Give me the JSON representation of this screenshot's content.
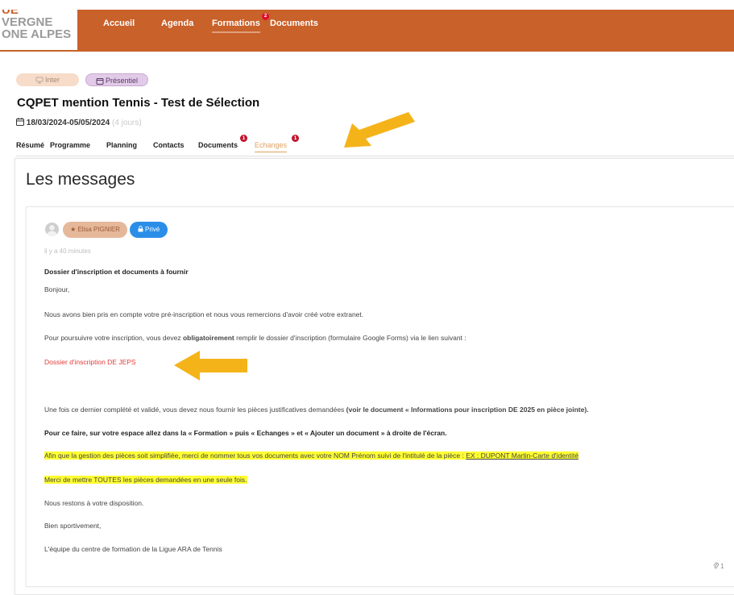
{
  "header": {
    "logo_lines": [
      "UE",
      "VERGNE",
      "ONE ALPES"
    ],
    "nav": [
      {
        "label": "Accueil"
      },
      {
        "label": "Agenda"
      },
      {
        "label": "Formations",
        "badge": "2"
      },
      {
        "label": "Documents"
      }
    ]
  },
  "training": {
    "chips": [
      {
        "label": "Inter",
        "icon": "monitor-icon"
      },
      {
        "label": "Présentiel",
        "icon": "calendar-icon"
      }
    ],
    "title": "CQPET mention Tennis - Test de Sélection",
    "dates": "18/03/2024-05/05/2024",
    "duration": "(4 jours)"
  },
  "tabs": [
    {
      "label": "Résumé"
    },
    {
      "label": "Programme"
    },
    {
      "label": "Planning"
    },
    {
      "label": "Contacts"
    },
    {
      "label": "Documents",
      "badge": "1"
    },
    {
      "label": "Echanges",
      "badge": "1"
    }
  ],
  "messages": {
    "section_title": "Les messages",
    "author": "Elisa PIGNIER",
    "private_label": "Privé",
    "time_ago": "il y a 40 minutes",
    "subject": "Dossier d'inscription et documents à fournir",
    "greeting": "Bonjour,",
    "p1": "Nous avons bien pris en compte votre pré-inscription et nous vous remercions d'avoir créé votre extranet.",
    "p2_before": "Pour poursuivre votre inscription, vous devez ",
    "p2_bold": "obligatoirement",
    "p2_after": " remplir le dossier d'inscription (formulaire Google Forms) via le lien suivant :",
    "link": "Dossier d'inscription DE JEPS",
    "p3_before": "Une fois ce dernier complété et validé, vous devez nous fournir les pièces justificatives demandées ",
    "p3_bold": "(voir le document « Informations pour inscription DE 2025 en pièce jointe).",
    "p4": "Pour ce faire, sur votre espace allez dans la « Formation » puis « Echanges » et « Ajouter un document » à droite de l'écran.",
    "p5": "Afin que la gestion des pièces soit simplifiée, merci de nommer tous vos documents avec votre NOM Prénom suivi de l'intitulé de la pièce :",
    "p5_example": "EX : DUPONT Martin-Carte d'identité",
    "p6": "Merci de mettre TOUTES les pièces demandées en une seule fois.",
    "p7": "Nous restons à votre disposition.",
    "p8": "Bien sportivement,",
    "p9": "L'équipe du centre de formation de la Ligue ARA de Tennis",
    "attachment_count": "1"
  },
  "colors": {
    "header": "#c9612a",
    "arrow": "#f5b31a",
    "highlight": "#ffff33",
    "private_badge": "#2a8ee8",
    "link": "#e23a3a"
  }
}
